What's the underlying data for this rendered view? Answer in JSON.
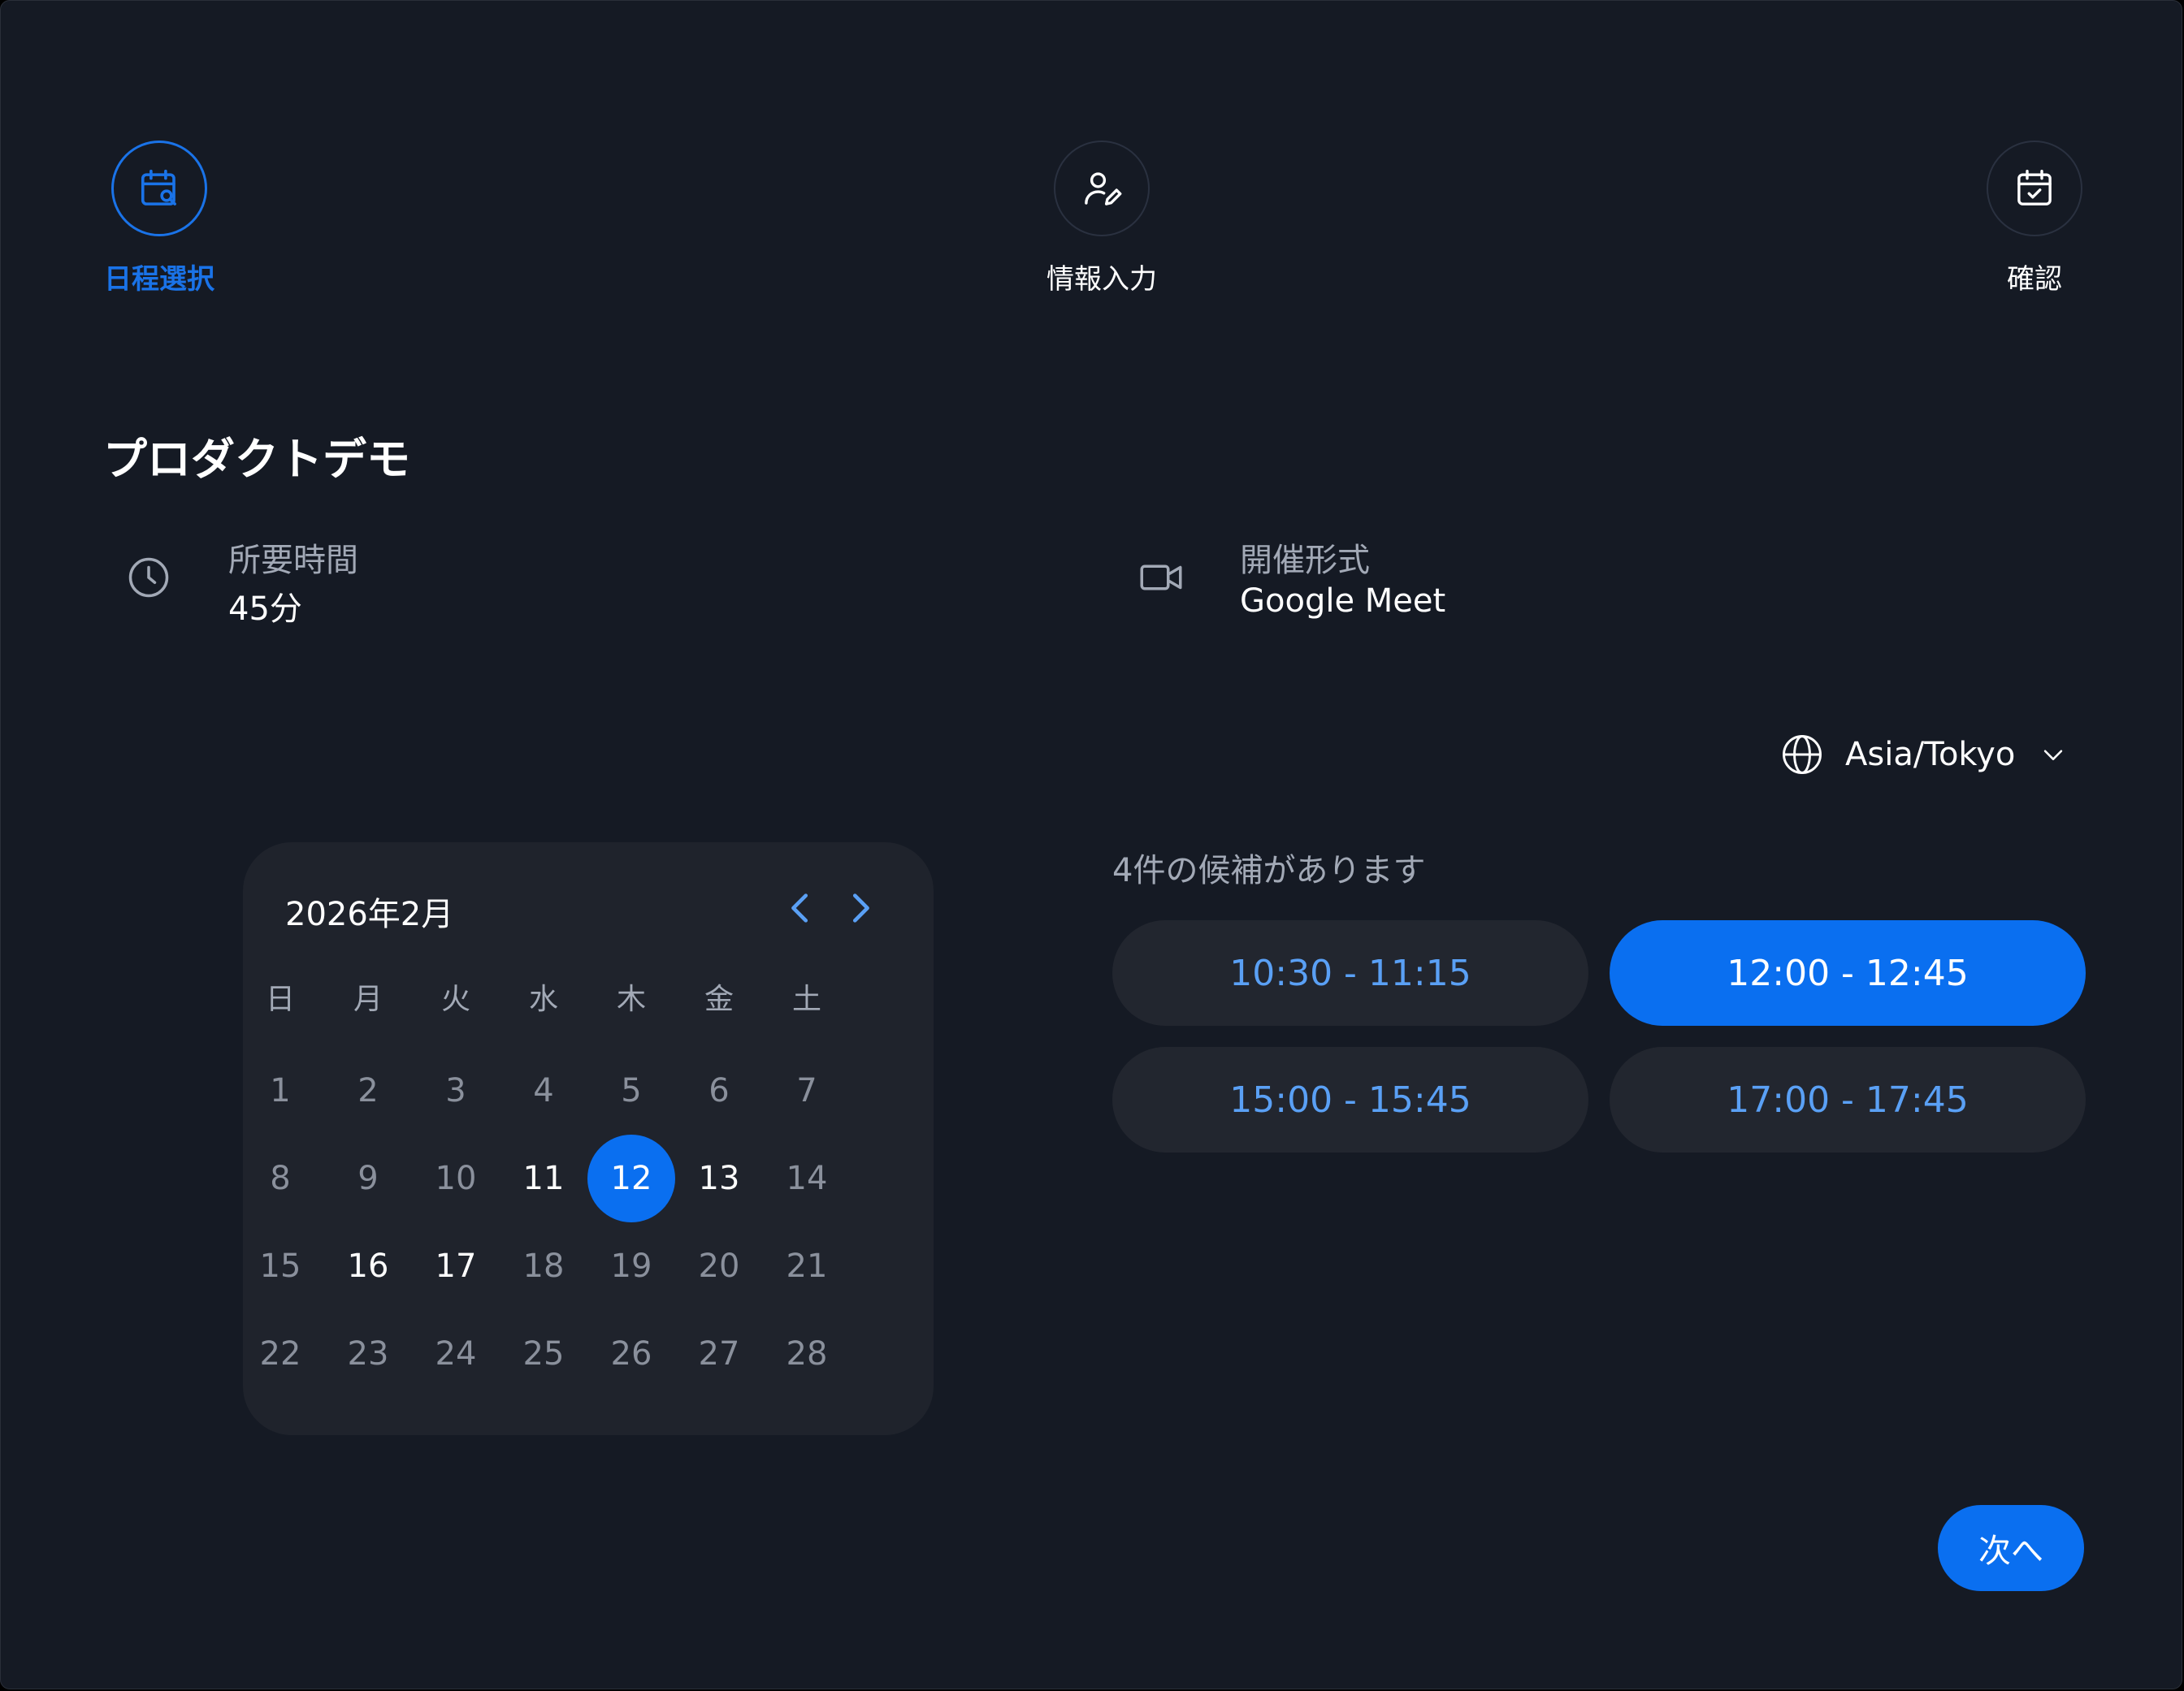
{
  "stepper": {
    "steps": [
      {
        "label": "日程選択",
        "icon": "calendar-search-icon",
        "active": true
      },
      {
        "label": "情報入力",
        "icon": "user-edit-icon",
        "active": false
      },
      {
        "label": "確認",
        "icon": "calendar-check-icon",
        "active": false
      }
    ]
  },
  "event": {
    "title": "プロダクトデモ",
    "duration_label": "所要時間",
    "duration_value": "45分",
    "format_label": "開催形式",
    "format_value": "Google Meet"
  },
  "timezone": {
    "value": "Asia/Tokyo"
  },
  "calendar": {
    "month_label": "2026年2月",
    "weekdays": [
      "日",
      "月",
      "火",
      "水",
      "木",
      "金",
      "土"
    ],
    "days": [
      "1",
      "2",
      "3",
      "4",
      "5",
      "6",
      "7",
      "8",
      "9",
      "10",
      "11",
      "12",
      "13",
      "14",
      "15",
      "16",
      "17",
      "18",
      "19",
      "20",
      "21",
      "22",
      "23",
      "24",
      "25",
      "26",
      "27",
      "28"
    ],
    "available_days": [
      "11",
      "12",
      "13",
      "16",
      "17"
    ],
    "selected_day": "12"
  },
  "slots": {
    "caption": "4件の候補があります",
    "items": [
      "10:30 - 11:15",
      "12:00 - 12:45",
      "15:00 - 15:45",
      "17:00 - 17:45"
    ],
    "selected": "12:00 - 12:45"
  },
  "footer": {
    "next_label": "次へ"
  },
  "colors": {
    "background": "#151a24",
    "accent": "#0a6ff0",
    "accent_text": "#5aa0f5",
    "panel": "#1f232c",
    "muted_text": "#a2a9b6"
  }
}
